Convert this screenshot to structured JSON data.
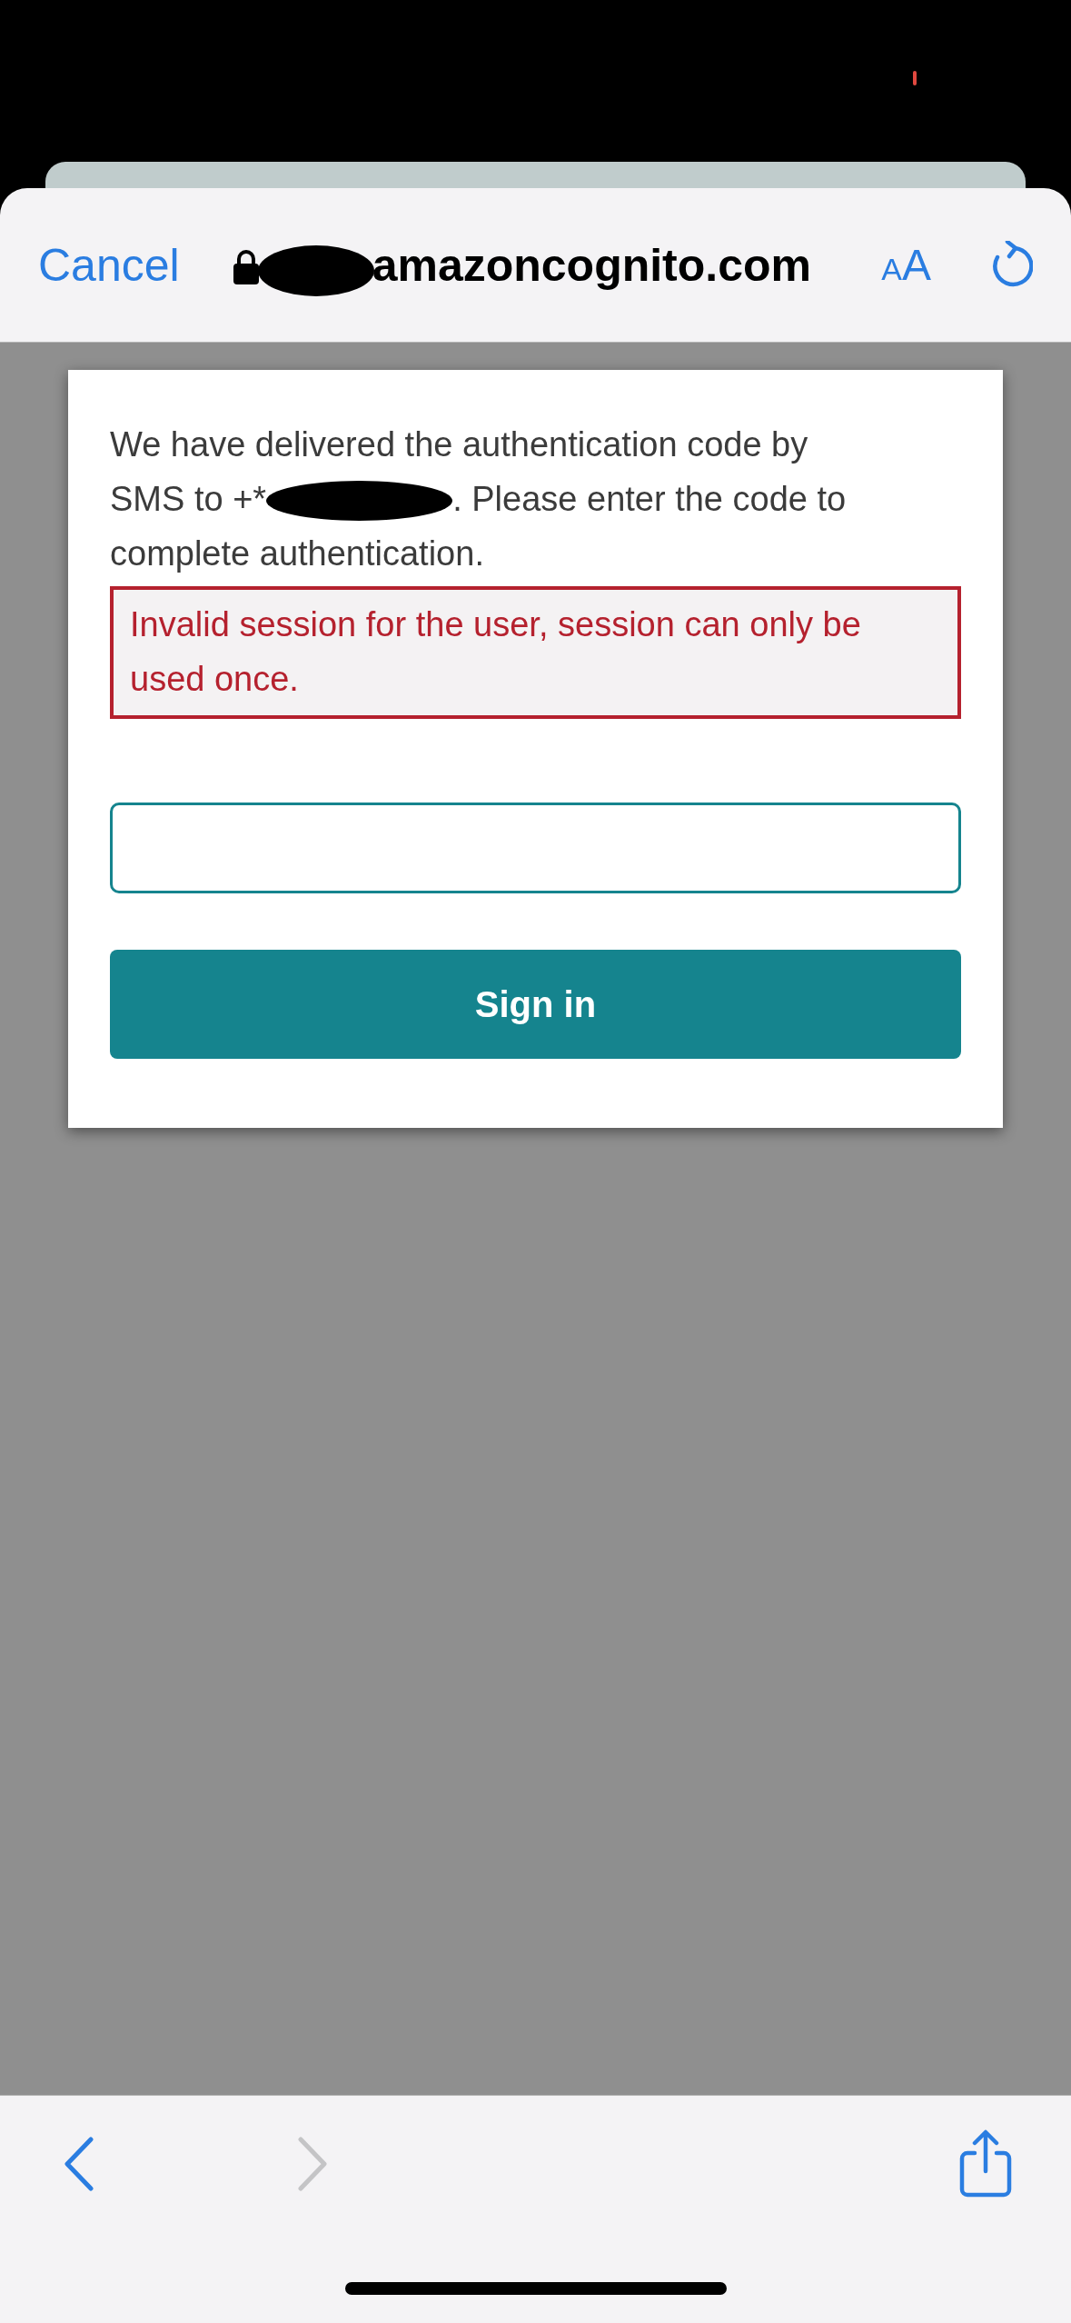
{
  "toolbar": {
    "cancel": "Cancel",
    "domain": "amazoncognito.com",
    "text_size": "AA"
  },
  "message": {
    "line_1": "We have delivered the authentication code by",
    "before_redaction": "SMS to +*",
    "after_redaction": ". Please enter the code to",
    "line_3": "complete authentication."
  },
  "error": "Invalid session for the user, session can only be used once.",
  "sign_in": "Sign in",
  "nav": {
    "back_disabled": false,
    "forward_disabled": true
  }
}
